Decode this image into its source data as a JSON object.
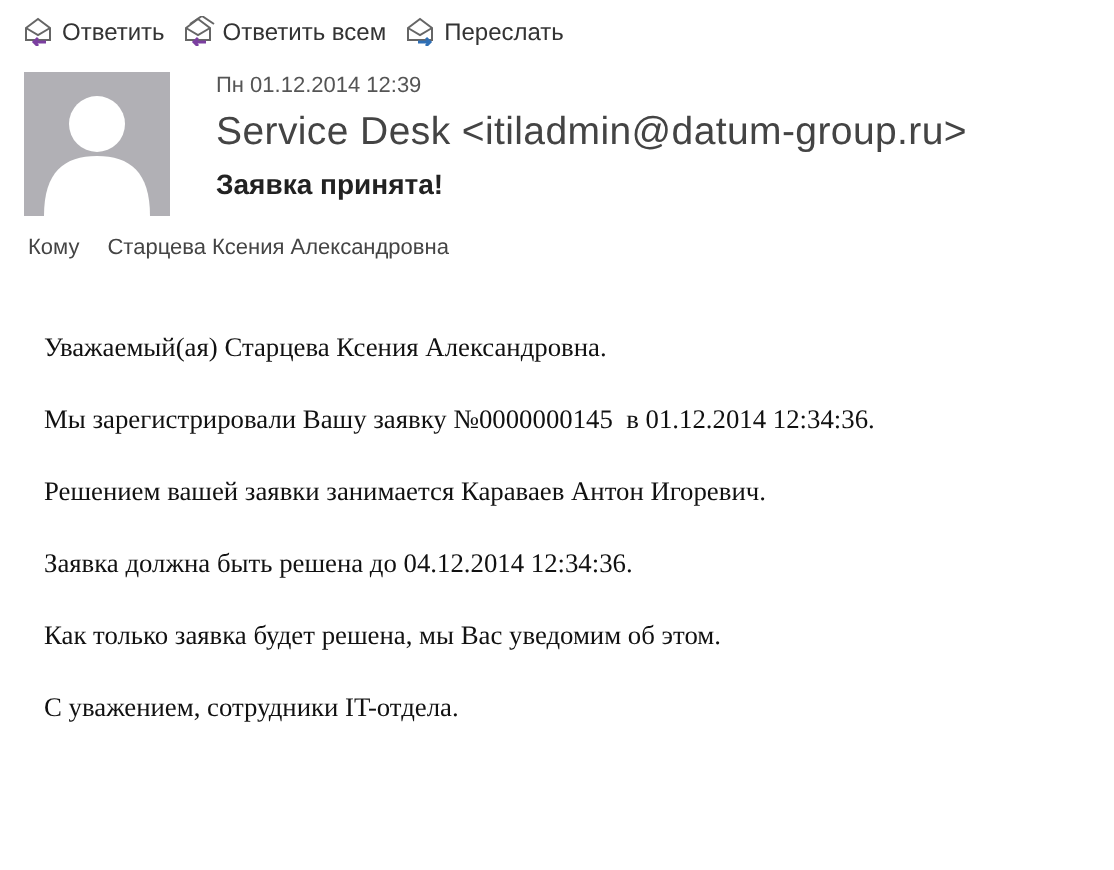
{
  "toolbar": [
    {
      "kind": "reply",
      "label": "Ответить"
    },
    {
      "kind": "reply_all",
      "label": "Ответить всем"
    },
    {
      "kind": "forward",
      "label": "Переслать"
    }
  ],
  "message": {
    "date": "Пн 01.12.2014 12:39",
    "sender": "Service Desk <itiladmin@datum-group.ru>",
    "subject": "Заявка принята!",
    "to_label": "Кому",
    "to": "Старцева Ксения Александровна"
  },
  "body": [
    "Уважаемый(ая) Старцева Ксения Александровна.",
    "Мы зарегистрировали Вашу заявку №0000000145  в 01.12.2014 12:34:36.",
    "Решением вашей заявки занимается Караваев Антон Игоревич.",
    "Заявка должна быть решена до 04.12.2014 12:34:36.",
    "Как только заявка будет решена, мы Вас уведомим об этом.",
    "С уважением, сотрудники IT-отдела."
  ]
}
